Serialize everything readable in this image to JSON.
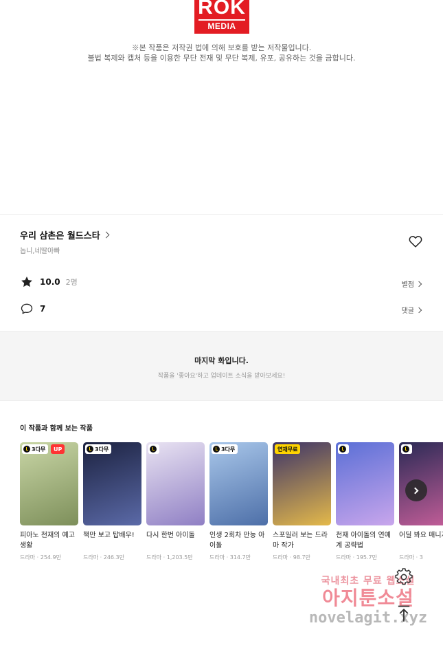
{
  "logo": {
    "top": "ROK",
    "bottom": "MEDIA"
  },
  "copyright": {
    "line1": "※본 작품은 저작권 법에 의해 보호를 받는 저작물입니다.",
    "line2": "불법 복제와 캡처 등을 이용한 무단 전재 및 무단 복제, 유포, 공유하는 것을 금합니다."
  },
  "work": {
    "title": "우리 삼촌은 월드스타",
    "authors": "놉니,네딸아빠",
    "score": "10.0",
    "raters": "2명",
    "rate_link": "별점",
    "comment_count": "7",
    "comment_link": "댓글"
  },
  "last_episode": {
    "heading": "마지막 화입니다.",
    "sub": "작품을 '좋아요'하고 업데이트 소식을 받아보세요!"
  },
  "recommend": {
    "title": "이 작품과 함께 보는 작품",
    "cards": [
      {
        "badge": "3다무",
        "badge_type": "timer",
        "up": "UP",
        "name": "피아노 천재의 예고 생활",
        "genre": "드라마",
        "views": "254.9만",
        "colors": [
          "#c9d6a6",
          "#7d8f5a"
        ]
      },
      {
        "badge": "3다무",
        "badge_type": "timer",
        "up": "",
        "name": "책만 보고 탑배우!",
        "genre": "드라마",
        "views": "246.3만",
        "colors": [
          "#1c2240",
          "#5b6aa8"
        ]
      },
      {
        "badge": "",
        "badge_type": "icon",
        "up": "",
        "name": "다시 한번 아이돌",
        "genre": "드라마",
        "views": "1,203.5만",
        "colors": [
          "#e9e3f2",
          "#8f7fc4"
        ]
      },
      {
        "badge": "3다무",
        "badge_type": "timer",
        "up": "",
        "name": "인생 2회차 만능 아이돌",
        "genre": "드라마",
        "views": "314.7만",
        "colors": [
          "#a9c7ea",
          "#4d6fa8"
        ]
      },
      {
        "badge": "연재무료",
        "badge_type": "free",
        "up": "",
        "name": "스포일러 보는 드라마 작가",
        "genre": "드라마",
        "views": "98.7만",
        "colors": [
          "#3d3468",
          "#e4b94a"
        ]
      },
      {
        "badge": "",
        "badge_type": "icon",
        "up": "",
        "name": "천재 아이돌의 연예계 공략법",
        "genre": "드라마",
        "views": "195.7만",
        "colors": [
          "#5a6fd6",
          "#c9a6ec"
        ]
      },
      {
        "badge": "",
        "badge_type": "icon",
        "up": "",
        "name": "어딜 봐요 매니저님",
        "genre": "드라마",
        "views": "3",
        "colors": [
          "#2a2a55",
          "#c75f9a"
        ]
      }
    ]
  },
  "icons": {
    "heart": "heart-outline-icon",
    "star": "star-icon",
    "comment": "comment-bubble-icon",
    "next": "chevron-right-icon",
    "settings": "gear-icon",
    "top": "arrow-up-icon"
  },
  "watermark": {
    "line1": "국내최초 무료 웹소설",
    "line2": "아지툰소설",
    "line3": "novelagit.xyz"
  }
}
